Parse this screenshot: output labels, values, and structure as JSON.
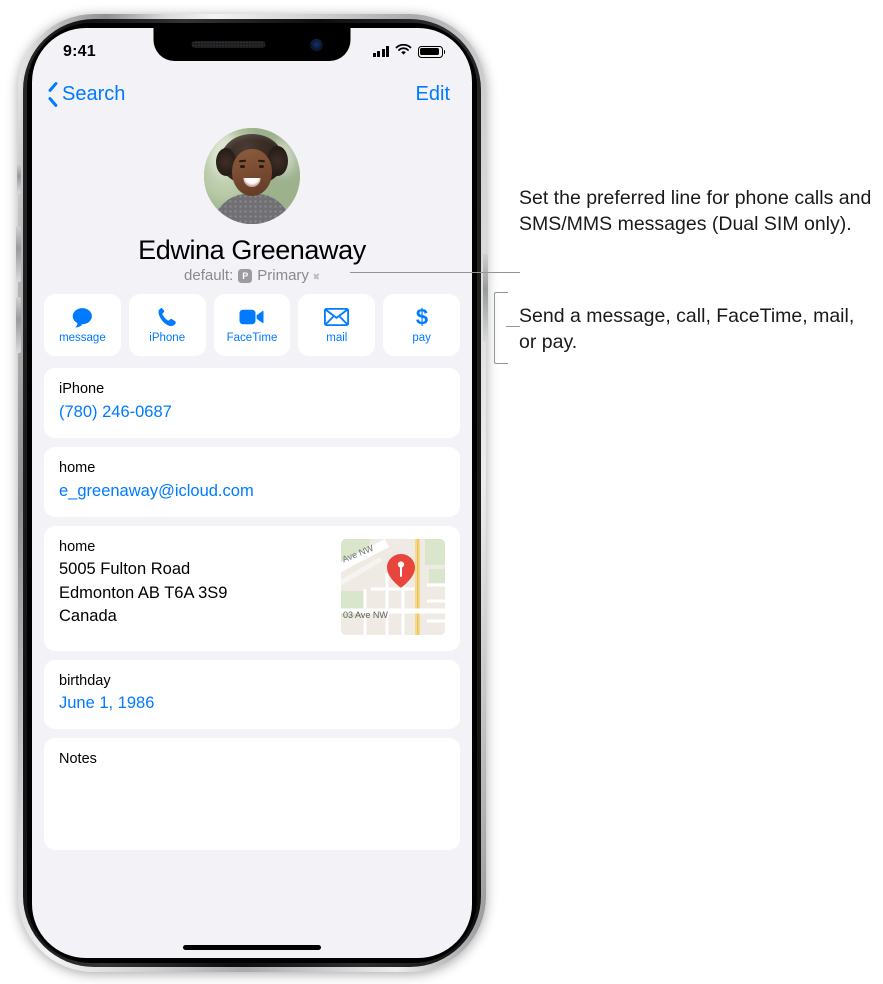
{
  "status_bar": {
    "time": "9:41",
    "cellular_icon": "cellular-signal-icon",
    "wifi_icon": "wifi-icon",
    "battery_icon": "battery-icon"
  },
  "nav": {
    "back_label": "Search",
    "back_icon": "chevron-left-icon",
    "edit_label": "Edit"
  },
  "contact": {
    "avatar_alt": "contact-photo",
    "name": "Edwina Greenaway",
    "default_line_prefix": "default:",
    "sim_badge": "P",
    "default_line_value": "Primary",
    "disclosure_icon": "chevron-right-icon"
  },
  "actions": [
    {
      "label": "message",
      "icon": "message-bubble-icon"
    },
    {
      "label": "iPhone",
      "icon": "phone-handset-icon"
    },
    {
      "label": "FaceTime",
      "icon": "video-camera-icon"
    },
    {
      "label": "mail",
      "icon": "envelope-icon"
    },
    {
      "label": "pay",
      "icon": "dollar-sign-icon"
    }
  ],
  "cards": {
    "phone": {
      "label": "iPhone",
      "value": "(780) 246-0687"
    },
    "email": {
      "label": "home",
      "value": "e_greenaway@icloud.com"
    },
    "address": {
      "label": "home",
      "line1": "5005 Fulton Road",
      "line2": "Edmonton AB T6A 3S9",
      "line3": "Canada",
      "map": {
        "icon": "map-pin-icon",
        "street_top": "Ave NW",
        "street_bottom": "03 Ave NW"
      }
    },
    "birthday": {
      "label": "birthday",
      "value": "June 1, 1986"
    },
    "notes": {
      "label": "Notes",
      "value": ""
    }
  },
  "callouts": [
    {
      "text": "Set the preferred line for phone calls and SMS/MMS messages (Dual SIM only)."
    },
    {
      "text": "Send a message, call, FaceTime, mail, or pay."
    }
  ],
  "colors": {
    "accent_blue": "#007AFF",
    "screen_background": "#F2F2F7",
    "card_background": "#FFFFFF",
    "secondary_text": "#8A8A8E",
    "pin_red": "#E8453C"
  }
}
